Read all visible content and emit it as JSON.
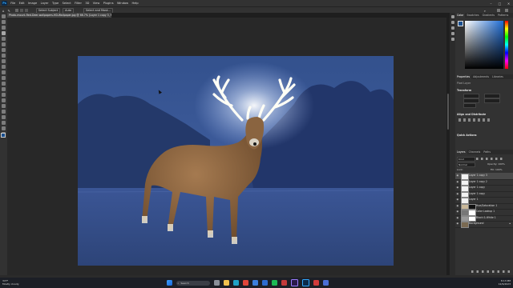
{
  "app": {
    "logo": "Ps",
    "menus": [
      "File",
      "Edit",
      "Image",
      "Layer",
      "Type",
      "Select",
      "Filter",
      "3D",
      "View",
      "Plugins",
      "Window",
      "Help"
    ],
    "window_controls": [
      "–",
      "□",
      "✕"
    ]
  },
  "options_bar": {
    "buttons": [
      "Select Subject",
      "Auto",
      "Select and Mask..."
    ]
  },
  "document_tab": {
    "title": "Photo-mount-Red-Deer-wallpapers-HD-Wallpaper.jpg @ 66.7% (Layer 1 copy 3, RGB/8#) * ×"
  },
  "panels": {
    "color_tabs": [
      "Color",
      "Swatches",
      "Gradients",
      "Patterns"
    ],
    "properties_tabs": [
      "Properties",
      "Adjustments",
      "Libraries"
    ],
    "properties": {
      "pixel_layer": "Pixel Layer",
      "transform": "Transform",
      "align": "Align and Distribute",
      "quick_actions": "Quick Actions"
    },
    "layers_tabs": [
      "Layers",
      "Channels",
      "Paths"
    ],
    "layers_search": "Kind",
    "blend_mode": "Normal",
    "opacity_label": "Opacity: 100%",
    "lock_label": "Lock:",
    "fill_label": "Fill: 100%",
    "layers": [
      {
        "name": "Layer 1 copy 3",
        "type": "white",
        "selected": true
      },
      {
        "name": "Layer 1 copy 2",
        "type": "white",
        "selected": false
      },
      {
        "name": "Layer 1 copy",
        "type": "white",
        "selected": false
      },
      {
        "name": "Layer 1 copy",
        "type": "white",
        "selected": false
      },
      {
        "name": "Layer 1",
        "type": "white",
        "selected": false
      },
      {
        "name": "Hue/Saturation 1",
        "type": "adjust",
        "selected": false
      },
      {
        "name": "Color Lookup 1",
        "type": "adjust",
        "selected": false
      },
      {
        "name": "Black & White 1",
        "type": "adjust",
        "selected": false
      },
      {
        "name": "Background",
        "type": "photo",
        "selected": false
      }
    ]
  },
  "taskbar": {
    "weather_temp": "34°F",
    "weather_desc": "Mostly cloudy",
    "search_placeholder": "Search",
    "time": "8:13 PM",
    "date": "12/6/2023"
  },
  "colors": {
    "accent": "#31a8ff",
    "canvas_sky": "#3d5a9a",
    "antler_glow": "#ffffff"
  }
}
